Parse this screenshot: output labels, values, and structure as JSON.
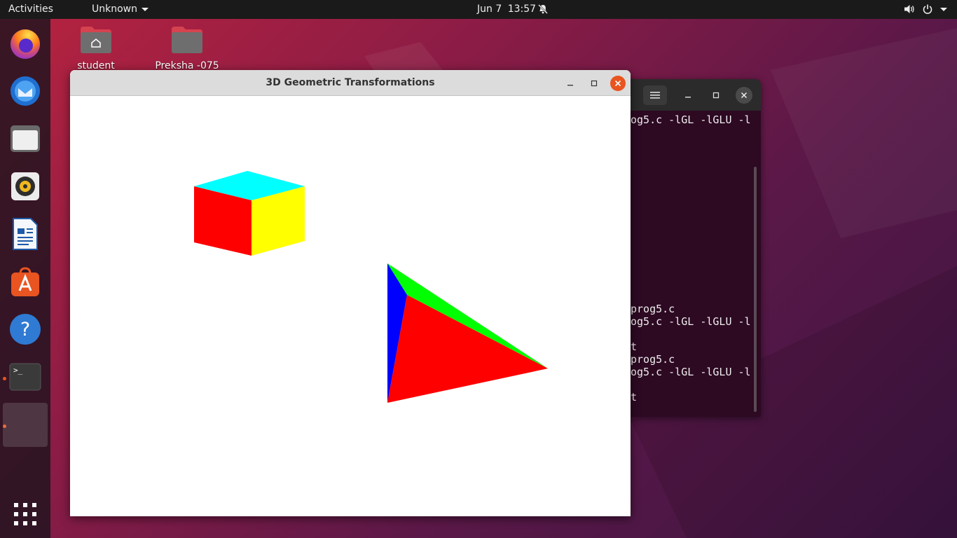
{
  "topbar": {
    "activities": "Activities",
    "app_menu": "Unknown",
    "date": "Jun 7",
    "time": "13:57"
  },
  "desktop_icons": [
    {
      "label": "student",
      "icon": "home-folder-icon"
    },
    {
      "label": "Preksha -075",
      "icon": "folder-icon"
    }
  ],
  "dock": [
    {
      "name": "Firefox",
      "icon": "firefox-icon"
    },
    {
      "name": "Thunderbird",
      "icon": "thunderbird-icon"
    },
    {
      "name": "Files",
      "icon": "files-icon"
    },
    {
      "name": "Rhythmbox",
      "icon": "rhythmbox-icon"
    },
    {
      "name": "LibreOffice Writer",
      "icon": "writer-icon"
    },
    {
      "name": "Ubuntu Software",
      "icon": "software-icon"
    },
    {
      "name": "Help",
      "icon": "help-icon"
    },
    {
      "name": "Terminal",
      "icon": "terminal-icon"
    },
    {
      "name": "3D Geometric Transformations",
      "icon": "app-window-icon"
    },
    {
      "name": "Show Applications",
      "icon": "app-grid-icon"
    }
  ],
  "gl_window": {
    "title": "3D Geometric Transformations",
    "colors": {
      "cube_top": "#00ffff",
      "cube_front": "#ff0000",
      "cube_side": "#ffff00",
      "tetra_front": "#ff0000",
      "tetra_left": "#0000ff",
      "tetra_top": "#00ff00"
    }
  },
  "terminal": {
    "lines": [
      "og5.c -lGL -lGLU -l",
      "prog5.c",
      "og5.c -lGL -lGLU -l",
      "t",
      "prog5.c",
      "og5.c -lGL -lGLU -l",
      "t"
    ]
  },
  "colors": {
    "accent": "#e95420",
    "topbar_bg": "#1a1a1a",
    "terminal_bg": "#2d0922"
  }
}
